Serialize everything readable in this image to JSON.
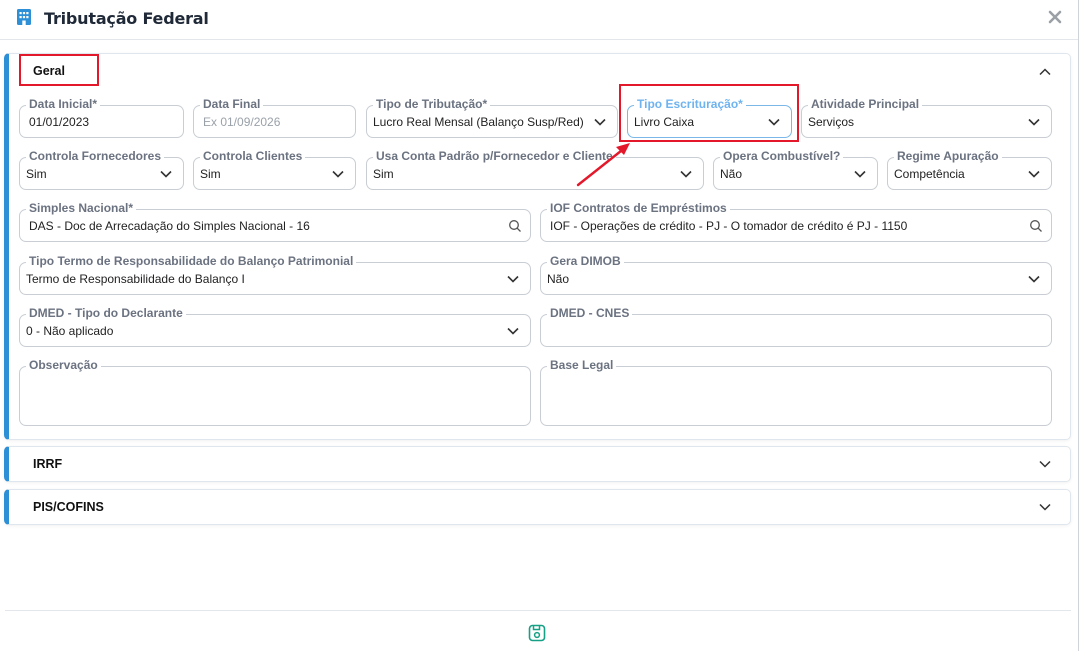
{
  "header": {
    "title": "Tributação Federal",
    "title_icon": "building-icon",
    "close_icon": "close-icon"
  },
  "sections": {
    "geral": {
      "title": "Geral",
      "expanded": true
    },
    "irrf": {
      "title": "IRRF",
      "expanded": false
    },
    "pis": {
      "title": "PIS/COFINS",
      "expanded": false
    }
  },
  "fields": {
    "data_inicial": {
      "label": "Data Inicial*",
      "value": "01/01/2023"
    },
    "data_final": {
      "label": "Data Final",
      "placeholder": "Ex 01/09/2026"
    },
    "tipo_tributacao": {
      "label": "Tipo de Tributação*",
      "value": "Lucro Real Mensal (Balanço Susp/Red)"
    },
    "tipo_escrituracao": {
      "label": "Tipo Escrituração*",
      "value": "Livro Caixa"
    },
    "atividade_principal": {
      "label": "Atividade Principal",
      "value": "Serviços"
    },
    "controla_fornecedores": {
      "label": "Controla Fornecedores",
      "value": "Sim"
    },
    "controla_clientes": {
      "label": "Controla Clientes",
      "value": "Sim"
    },
    "usa_conta_padrao": {
      "label": "Usa Conta Padrão p/Fornecedor e Cliente",
      "value": "Sim"
    },
    "opera_combustivel": {
      "label": "Opera Combustível?",
      "value": "Não"
    },
    "regime_apuracao": {
      "label": "Regime Apuração",
      "value": "Competência"
    },
    "simples_nacional": {
      "label": "Simples Nacional*",
      "value": "DAS - Doc de Arrecadação do Simples Nacional - 16"
    },
    "iof_contratos": {
      "label": "IOF Contratos de Empréstimos",
      "value": "IOF - Operações de crédito - PJ - O tomador de crédito é PJ - 1150"
    },
    "tipo_termo": {
      "label": "Tipo Termo de Responsabilidade do Balanço Patrimonial",
      "value": "Termo de Responsabilidade do Balanço I"
    },
    "gera_dimob": {
      "label": "Gera DIMOB",
      "value": "Não"
    },
    "dmed_tipo": {
      "label": "DMED - Tipo do Declarante",
      "value": "0 - Não aplicado"
    },
    "dmed_cnes": {
      "label": "DMED - CNES",
      "value": ""
    },
    "observacao": {
      "label": "Observação",
      "value": ""
    },
    "base_legal": {
      "label": "Base Legal",
      "value": ""
    }
  },
  "colors": {
    "accent": "#2d8fd5",
    "highlight": "#e3192b",
    "save": "#16a085"
  }
}
